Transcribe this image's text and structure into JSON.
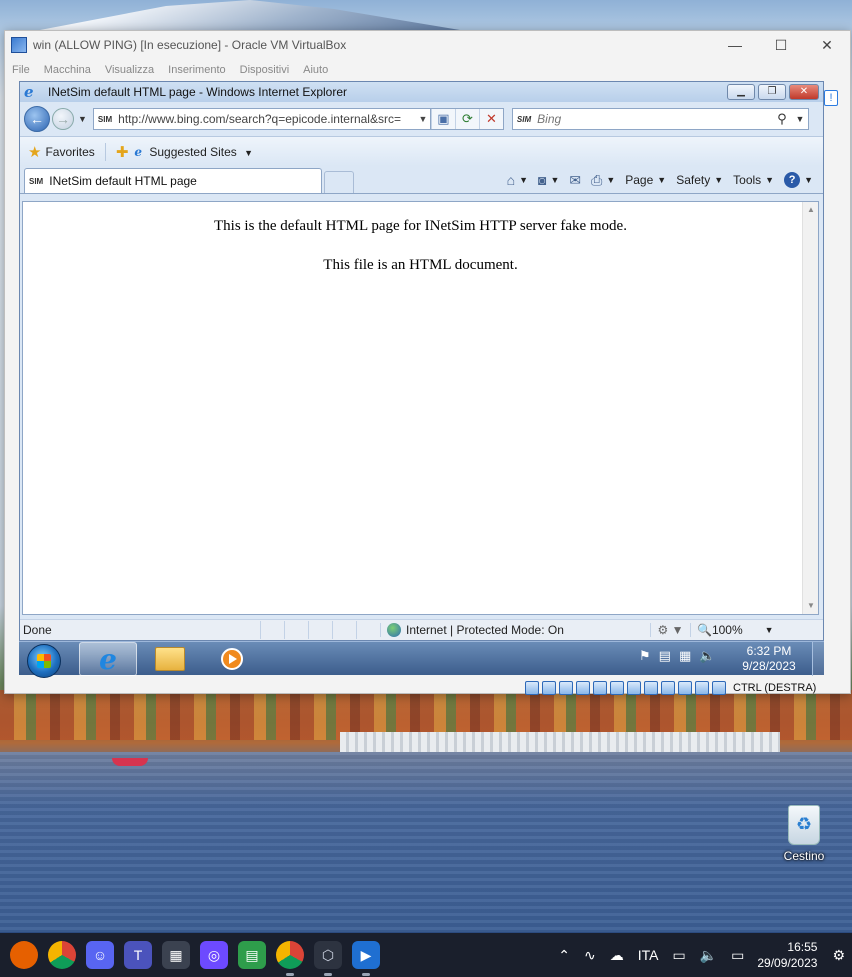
{
  "vbox": {
    "title": "win (ALLOW PING) [In esecuzione] - Oracle VM VirtualBox",
    "menu": [
      "File",
      "Macchina",
      "Visualizza",
      "Inserimento",
      "Dispositivi",
      "Aiuto"
    ],
    "host_key": "CTRL (DESTRA)"
  },
  "ie": {
    "title": "INetSim default HTML page - Windows Internet Explorer",
    "url": "http://www.bing.com/search?q=epicode.internal&src=",
    "url_badge": "SIM",
    "search_placeholder": "Bing",
    "favorites_label": "Favorites",
    "suggested_sites_label": "Suggested Sites",
    "tab_title": "INetSim default HTML page",
    "commands": {
      "page": "Page",
      "safety": "Safety",
      "tools": "Tools"
    },
    "content": {
      "line1": "This is the default HTML page for INetSim HTTP server fake mode.",
      "line2": "This file is an HTML document."
    },
    "status": {
      "state": "Done",
      "zone": "Internet | Protected Mode: On",
      "zoom": "100%"
    }
  },
  "guest_taskbar": {
    "time": "6:32 PM",
    "date": "9/28/2023"
  },
  "desktop": {
    "recycle_bin_label": "Cestino"
  },
  "host_taskbar": {
    "language": "ITA",
    "time": "16:55",
    "date": "29/09/2023",
    "apps": [
      "firefox-icon",
      "chrome-icon",
      "discord-icon",
      "teams-icon",
      "calculator-icon",
      "proton-icon",
      "tool-icon",
      "chrome-icon",
      "virtualbox-icon",
      "media-player-icon"
    ]
  },
  "colors": {
    "ie_chrome": "#dbe7f5",
    "host_taskbar": "#1a1f2c",
    "win7_taskbar": "#3c5d8c"
  }
}
